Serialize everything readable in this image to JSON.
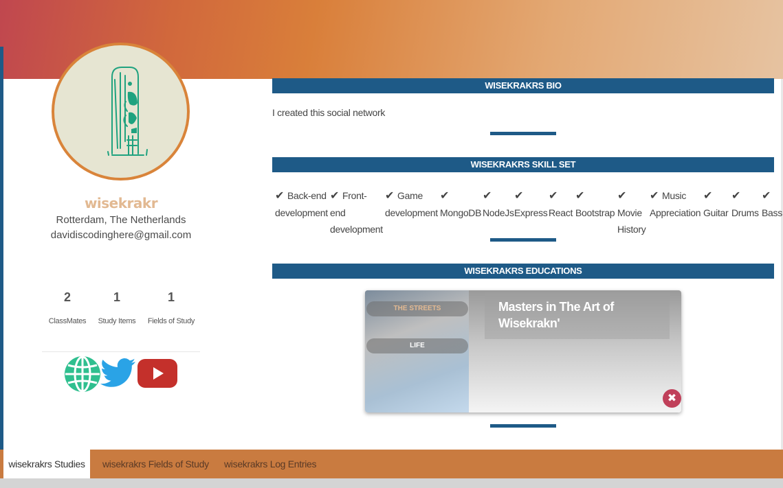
{
  "colors": {
    "accent": "#1e5a87",
    "banner_start": "#c0474f",
    "banner_end": "#e6c3a1",
    "username": "#e2b992",
    "tab_bar": "#c97b40",
    "close_button": "#c0405a"
  },
  "profile": {
    "username": "wisekrakr",
    "location": "Rotterdam, The Netherlands",
    "email": "davidiscodinghere@gmail.com",
    "avatar_icon": "skull-doodle-icon",
    "stats": [
      {
        "value": "2",
        "label": "ClassMates"
      },
      {
        "value": "1",
        "label": "Study Items"
      },
      {
        "value": "1",
        "label": "Fields of Study"
      }
    ],
    "social": [
      "globe-icon",
      "twitter-icon",
      "youtube-icon"
    ]
  },
  "bio": {
    "heading": "WISEKRAKRS BIO",
    "text": "I created this social network"
  },
  "skills": {
    "heading": "WISEKRAKRS SKILL SET",
    "icon": "check-icon",
    "items": [
      {
        "line1": "Back-end",
        "line2": "development",
        "line3": ""
      },
      {
        "line1": "Front-",
        "line2": "end",
        "line3": "development"
      },
      {
        "line1": "Game",
        "line2": "development",
        "line3": ""
      },
      {
        "line1": "",
        "line2": "MongoDB",
        "line3": ""
      },
      {
        "line1": "",
        "line2": "NodeJs",
        "line3": ""
      },
      {
        "line1": "",
        "line2": "Express",
        "line3": ""
      },
      {
        "line1": "",
        "line2": "React",
        "line3": ""
      },
      {
        "line1": "",
        "line2": "Bootstrap",
        "line3": ""
      },
      {
        "line1": "",
        "line2": "Movie",
        "line3": "History"
      },
      {
        "line1": "Music",
        "line2": "Appreciation",
        "line3": ""
      },
      {
        "line1": "",
        "line2": "Guitar",
        "line3": ""
      },
      {
        "line1": "",
        "line2": "Drums",
        "line3": ""
      },
      {
        "line1": "",
        "line2": "Bass",
        "line3": ""
      }
    ]
  },
  "educations": {
    "heading": "WISEKRAKRS EDUCATIONS",
    "tabs": [
      "THE STREETS",
      "LIFE"
    ],
    "title": "Masters in The Art of Wisekrakn'",
    "close_symbol": "✖"
  },
  "bottom_tabs": [
    {
      "label": "wisekrakrs Studies",
      "active": true
    },
    {
      "label": "wisekrakrs Fields of Study",
      "active": false
    },
    {
      "label": "wisekrakrs Log Entries",
      "active": false
    }
  ]
}
